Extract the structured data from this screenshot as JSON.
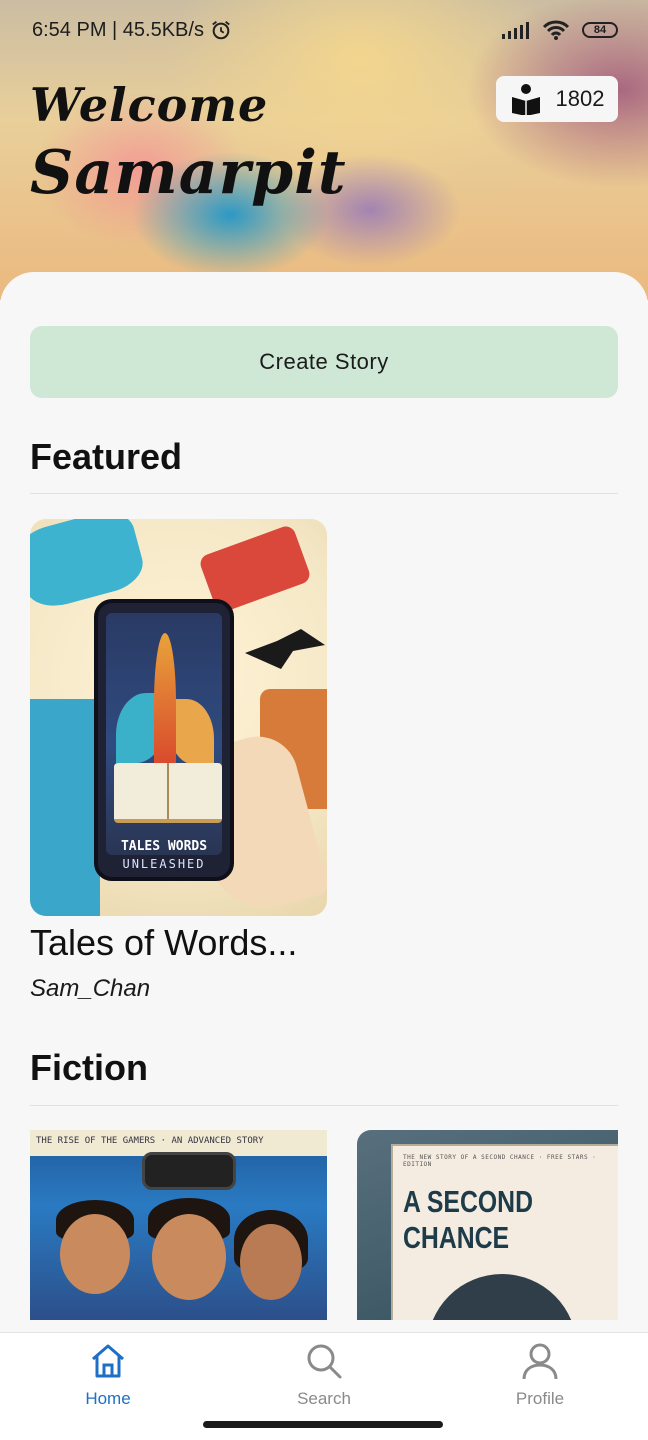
{
  "status_bar": {
    "time_speed": "6:54 PM | 45.5KB/s",
    "battery": "84"
  },
  "header": {
    "welcome": "Welcome",
    "username": "Samarpit",
    "reads_count": "1802"
  },
  "create_button": "Create Story",
  "sections": {
    "featured": {
      "title": "Featured",
      "books": [
        {
          "cover_line1": "TALES    WORDS",
          "cover_line2": "UNLEASHED",
          "title": "Tales of Words...",
          "author": "Sam_Chan"
        }
      ]
    },
    "fiction": {
      "title": "Fiction",
      "covers": [
        {
          "top_text": "THE RISE OF THE GAMERS  ·  AN ADVANCED STORY"
        },
        {
          "title": "A SECOND CHANCE",
          "top_text": "THE NEW STORY OF A SECOND CHANCE · FREE STARS · EDITION"
        }
      ]
    }
  },
  "bottom_nav": [
    {
      "label": "Home",
      "icon": "home-icon",
      "active": true
    },
    {
      "label": "Search",
      "icon": "search-icon",
      "active": false
    },
    {
      "label": "Profile",
      "icon": "profile-icon",
      "active": false
    }
  ],
  "colors": {
    "accent": "#1e6fc6",
    "inactive": "#8a8a8a",
    "create_button_bg": "#cfe8d6"
  }
}
